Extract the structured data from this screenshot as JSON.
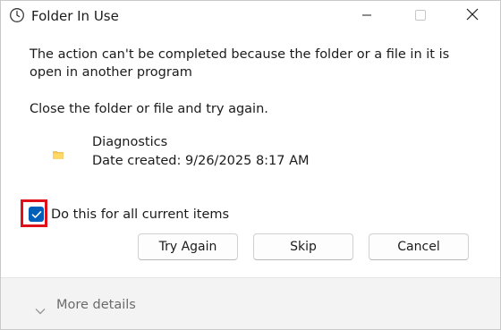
{
  "window": {
    "title": "Folder In Use",
    "title_icon": "clock-icon"
  },
  "titlebar_buttons": {
    "minimize_icon": "minimize-icon",
    "maximize_icon": "maximize-icon",
    "close_icon": "close-icon"
  },
  "message": "The action can't be completed because the folder or a file in it is open in another program",
  "instruction": "Close the folder or file and try again.",
  "item": {
    "icon": "folder-icon",
    "name": "Diagnostics",
    "date_created": "Date created: 9/26/2025 8:17 AM"
  },
  "apply_all": {
    "label": "Do this for all current items",
    "checked": true
  },
  "buttons": {
    "try_again": "Try Again",
    "skip": "Skip",
    "cancel": "Cancel"
  },
  "footer": {
    "more_details": "More details",
    "chevron_icon": "chevron-down-icon"
  },
  "colors": {
    "accent": "#005fb8",
    "highlight": "#e0101a",
    "footer_bg": "#f3f3f3",
    "muted_text": "#6b6b6b"
  }
}
